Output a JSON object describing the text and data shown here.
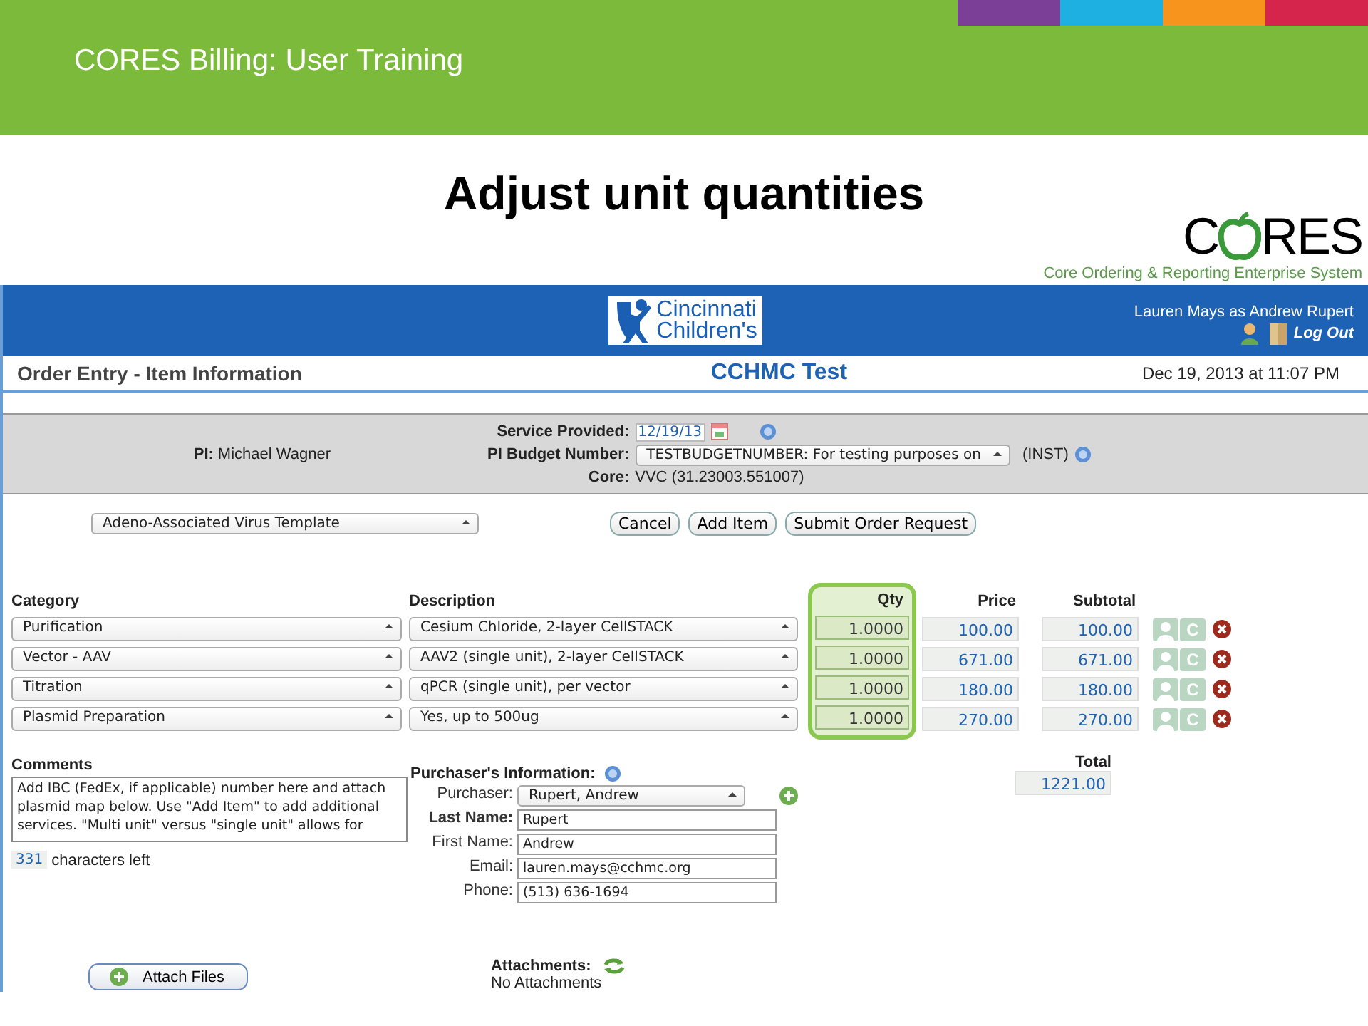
{
  "banner": {
    "title": "CORES Billing: User Training"
  },
  "slide_title": "Adjust unit quantities",
  "cores_logo": {
    "word_start": "C",
    "word_end": "RES",
    "tagline": "Core Ordering & Reporting Enterprise System"
  },
  "app_header": {
    "logo_lines": [
      "Cincinnati",
      "Children's"
    ],
    "user": "Lauren Mays as Andrew Rupert",
    "logout": "Log Out"
  },
  "page_bar": {
    "title": "Order Entry - Item Information",
    "center": "CCHMC Test",
    "datetime": "Dec 19, 2013 at 11:07 PM"
  },
  "order_info": {
    "pi_label": "PI:",
    "pi": "Michael Wagner",
    "service_label": "Service Provided:",
    "service_date": "12/19/13",
    "budget_label": "PI Budget Number:",
    "budget": "TESTBUDGETNUMBER: For testing purposes on",
    "budget_suffix": "(INST)",
    "core_label": "Core:",
    "core": "VVC (31.23003.551007)"
  },
  "template": "Adeno-Associated Virus Template",
  "actions": [
    "Cancel",
    "Add Item",
    "Submit Order Request"
  ],
  "items": {
    "columns": [
      "Category",
      "Description",
      "Qty",
      "Price",
      "Subtotal"
    ],
    "qty_highlighted": true,
    "rows": [
      {
        "category": "Purification",
        "description": "Cesium Chloride, 2-layer CellSTACK",
        "qty": "1.0000",
        "price": "100.00",
        "subtotal": "100.00",
        "copy": "C"
      },
      {
        "category": "Vector - AAV",
        "description": "AAV2 (single unit), 2-layer CellSTACK",
        "qty": "1.0000",
        "price": "671.00",
        "subtotal": "671.00",
        "copy": "C"
      },
      {
        "category": "Titration",
        "description": "qPCR (single unit), per vector",
        "qty": "1.0000",
        "price": "180.00",
        "subtotal": "180.00",
        "copy": "C"
      },
      {
        "category": "Plasmid Preparation",
        "description": "Yes, up to 500ug",
        "qty": "1.0000",
        "price": "270.00",
        "subtotal": "270.00",
        "copy": "C"
      }
    ]
  },
  "total": {
    "label": "Total",
    "value": "1221.00"
  },
  "comments": {
    "label": "Comments",
    "text": "Add IBC (FedEx, if applicable) number here and attach plasmid map below. Use \"Add Item\" to add additional services. \"Multi unit\" versus \"single unit\" allows for",
    "remaining": "331",
    "remaining_label": "characters left"
  },
  "purchaser": {
    "title": "Purchaser's Information:",
    "fields": [
      {
        "label": "Purchaser:",
        "value": "Rupert, Andrew",
        "kind": "select",
        "required": false
      },
      {
        "label": "Last Name:",
        "value": "Rupert",
        "kind": "text",
        "required": true
      },
      {
        "label": "First Name:",
        "value": "Andrew",
        "kind": "text",
        "required": false
      },
      {
        "label": "Email:",
        "value": "lauren.mays@cchmc.org",
        "kind": "text",
        "required": false
      },
      {
        "label": "Phone:",
        "value": "(513) 636-1694",
        "kind": "text",
        "required": false
      }
    ]
  },
  "attach_button": "Attach Files",
  "attachments": {
    "label": "Attachments:",
    "value": "No Attachments"
  }
}
